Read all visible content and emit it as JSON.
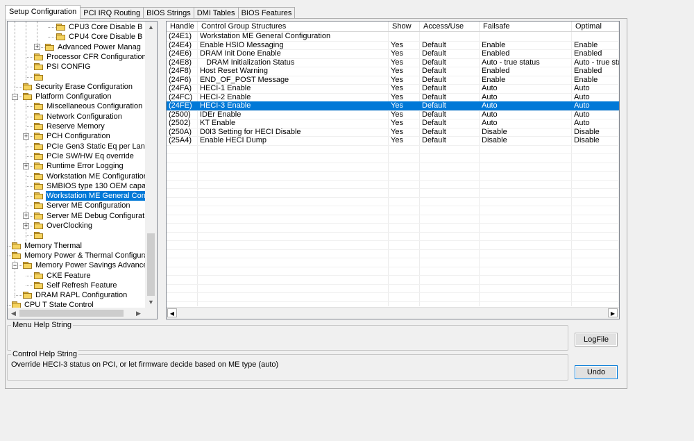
{
  "tabs": [
    {
      "label": "Setup Configuration",
      "active": true
    },
    {
      "label": "PCI IRQ Routing",
      "active": false
    },
    {
      "label": "BIOS Strings",
      "active": false
    },
    {
      "label": "DMI Tables",
      "active": false
    },
    {
      "label": "BIOS Features",
      "active": false
    }
  ],
  "tree": {
    "items": [
      {
        "label": "CPU3 Core Disable B",
        "level": 4,
        "expander": "",
        "selected": false
      },
      {
        "label": "CPU4 Core Disable B",
        "level": 4,
        "expander": "",
        "selected": false
      },
      {
        "label": "Advanced Power Manag",
        "level": 3,
        "expander": "+",
        "selected": false
      },
      {
        "label": "Processor CFR Configuration",
        "level": 2,
        "expander": "",
        "selected": false
      },
      {
        "label": "PSI CONFIG",
        "level": 2,
        "expander": "",
        "selected": false
      },
      {
        "label": "",
        "level": 2,
        "expander": "",
        "selected": false
      },
      {
        "label": "Security Erase Configuration",
        "level": 1,
        "expander": "",
        "selected": false
      },
      {
        "label": "Platform Configuration",
        "level": 1,
        "expander": "-",
        "selected": false
      },
      {
        "label": "Miscellaneous Configuration",
        "level": 2,
        "expander": "",
        "selected": false
      },
      {
        "label": "Network Configuration",
        "level": 2,
        "expander": "",
        "selected": false
      },
      {
        "label": "Reserve Memory",
        "level": 2,
        "expander": "",
        "selected": false
      },
      {
        "label": "PCH Configuration",
        "level": 2,
        "expander": "+",
        "selected": false
      },
      {
        "label": "PCIe Gen3 Static Eq per Lan",
        "level": 2,
        "expander": "",
        "selected": false
      },
      {
        "label": "PCIe SW/HW Eq override",
        "level": 2,
        "expander": "",
        "selected": false
      },
      {
        "label": "Runtime Error Logging",
        "level": 2,
        "expander": "+",
        "selected": false
      },
      {
        "label": "Workstation ME Configuratior",
        "level": 2,
        "expander": "",
        "selected": false
      },
      {
        "label": "SMBIOS type 130 OEM capa",
        "level": 2,
        "expander": "",
        "selected": false
      },
      {
        "label": "Workstation ME General Con",
        "level": 2,
        "expander": "",
        "selected": true
      },
      {
        "label": "Server ME Configuration",
        "level": 2,
        "expander": "",
        "selected": false
      },
      {
        "label": "Server ME Debug Configurati",
        "level": 2,
        "expander": "+",
        "selected": false
      },
      {
        "label": "OverClocking",
        "level": 2,
        "expander": "+",
        "selected": false
      },
      {
        "label": "",
        "level": 2,
        "expander": "",
        "selected": false
      },
      {
        "label": "Memory Thermal",
        "level": 0,
        "expander": "",
        "selected": false
      },
      {
        "label": "Memory Power & Thermal Configuratic",
        "level": 0,
        "expander": "-",
        "selected": false
      },
      {
        "label": "Memory Power Savings Advance",
        "level": 1,
        "expander": "-",
        "selected": false
      },
      {
        "label": "CKE Feature",
        "level": 2,
        "expander": "",
        "selected": false
      },
      {
        "label": "Self Refresh Feature",
        "level": 2,
        "expander": "",
        "selected": false
      },
      {
        "label": "DRAM RAPL Configuration",
        "level": 1,
        "expander": "",
        "selected": false
      },
      {
        "label": "CPU T State Control",
        "level": 0,
        "expander": "",
        "selected": false
      }
    ]
  },
  "grid": {
    "columns": [
      "Handle",
      "Control Group Structures",
      "Show",
      "Access/Use",
      "Failsafe",
      "Optimal"
    ],
    "rows": [
      {
        "cells": [
          "(24E1)",
          "Workstation ME General Configuration",
          "",
          "",
          "",
          ""
        ],
        "selected": false
      },
      {
        "cells": [
          "(24E4)",
          "Enable HSIO Messaging",
          "Yes",
          "Default",
          "Enable",
          "Enable"
        ],
        "selected": false
      },
      {
        "cells": [
          "(24E6)",
          "DRAM Init Done Enable",
          "Yes",
          "Default",
          "Enabled",
          "Enabled"
        ],
        "selected": false
      },
      {
        "cells": [
          "(24E8)",
          "   DRAM Initialization Status",
          "Yes",
          "Default",
          "Auto - true status",
          "Auto - true sta"
        ],
        "selected": false
      },
      {
        "cells": [
          "(24F8)",
          "Host Reset Warning",
          "Yes",
          "Default",
          "Enabled",
          "Enabled"
        ],
        "selected": false
      },
      {
        "cells": [
          "(24F6)",
          "END_OF_POST Message",
          "Yes",
          "Default",
          "Enable",
          "Enable"
        ],
        "selected": false
      },
      {
        "cells": [
          "(24FA)",
          "HECI-1 Enable",
          "Yes",
          "Default",
          "Auto",
          "Auto"
        ],
        "selected": false
      },
      {
        "cells": [
          "(24FC)",
          "HECI-2 Enable",
          "Yes",
          "Default",
          "Auto",
          "Auto"
        ],
        "selected": false
      },
      {
        "cells": [
          "(24FE)",
          "HECI-3 Enable",
          "Yes",
          "Default",
          "Auto",
          "Auto"
        ],
        "selected": true
      },
      {
        "cells": [
          "(2500)",
          "IDEr Enable",
          "Yes",
          "Default",
          "Auto",
          "Auto"
        ],
        "selected": false
      },
      {
        "cells": [
          "(2502)",
          "KT Enable",
          "Yes",
          "Default",
          "Auto",
          "Auto"
        ],
        "selected": false
      },
      {
        "cells": [
          "(250A)",
          "D0I3 Setting for HECI Disable",
          "Yes",
          "Default",
          "Disable",
          "Disable"
        ],
        "selected": false
      },
      {
        "cells": [
          "(25A4)",
          "Enable HECI Dump",
          "Yes",
          "Default",
          "Disable",
          "Disable"
        ],
        "selected": false
      }
    ]
  },
  "menu_help": {
    "title": "Menu Help String",
    "text": ""
  },
  "control_help": {
    "title": "Control Help String",
    "text": "Override HECI-3 status on PCI, or let firmware decide based on ME type (auto)"
  },
  "buttons": {
    "logfile": "LogFile",
    "undo": "Undo"
  },
  "colors": {
    "selection": "#0078d7",
    "folder": "#f5d35f"
  }
}
